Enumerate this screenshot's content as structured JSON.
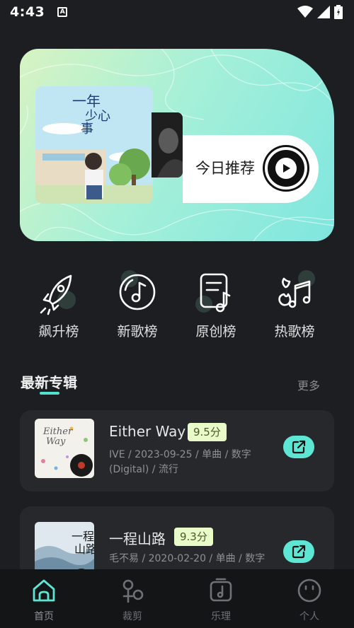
{
  "status_bar": {
    "time": "4:43",
    "notification_icon": "A"
  },
  "hero": {
    "recommend_label": "今日推荐",
    "cover_title_lines": [
      "一年",
      "少心",
      "事"
    ]
  },
  "charts": [
    {
      "label": "飙升榜",
      "icon": "rocket-icon"
    },
    {
      "label": "新歌榜",
      "icon": "vinyl-note-icon"
    },
    {
      "label": "原创榜",
      "icon": "document-note-icon"
    },
    {
      "label": "热歌榜",
      "icon": "fire-music-icon"
    }
  ],
  "section": {
    "title": "最新专辑",
    "more": "更多"
  },
  "albums": [
    {
      "name": "Either Way",
      "score": "9.5分",
      "meta": "IVE / 2023-09-25 / 单曲 / 数字 (Digital) / 流行"
    },
    {
      "name": "一程山路",
      "score": "9.3分",
      "meta": "毛不易 / 2020-02-20 / 单曲 / 数字"
    }
  ],
  "tabs": [
    {
      "label": "首页",
      "icon": "home-icon"
    },
    {
      "label": "裁剪",
      "icon": "scissors-icon"
    },
    {
      "label": "乐理",
      "icon": "music-box-icon"
    },
    {
      "label": "个人",
      "icon": "face-icon"
    }
  ],
  "colors": {
    "accent": "#53e0cf",
    "background": "#1c1e21",
    "card": "#26282c",
    "score_bg": "#e9fbc8"
  }
}
